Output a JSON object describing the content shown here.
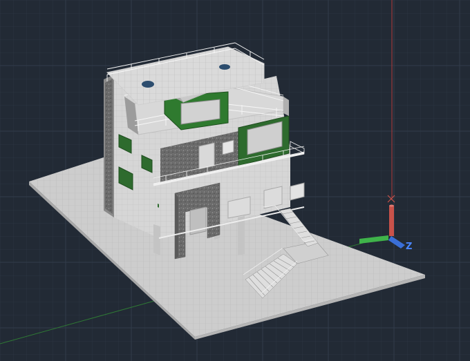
{
  "viewport": {
    "background": "#222a35",
    "grid_minor_color": "#2b3441",
    "grid_major_color": "#323c4a"
  },
  "model": {
    "ground_color": "#cfcfcf",
    "wall_color": "#d3d3d3",
    "stone_color": "#6f6f6f",
    "glass_color": "#2e7d2e",
    "railing_color": "#f2f2f2"
  },
  "ucs_icon": {
    "x_axis_color": "#c8524a",
    "y_axis_color": "#3fb34a",
    "z_axis_color": "#3a6fd8",
    "label_z": "Z"
  },
  "crosshair": {
    "color": "#b23a3a"
  }
}
